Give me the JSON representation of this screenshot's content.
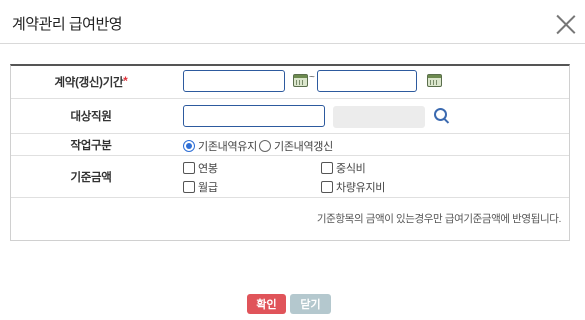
{
  "dialog": {
    "title": "계약관리 급여반영"
  },
  "form": {
    "period": {
      "label": "계약(갱신)기간",
      "required_mark": "*",
      "start_value": "",
      "end_value": "",
      "separator": "~"
    },
    "employee": {
      "label": "대상직원",
      "value": "",
      "name_value": ""
    },
    "work_type": {
      "label": "작업구분",
      "options": [
        {
          "label": "기존내역유지",
          "checked": true
        },
        {
          "label": "기존내역갱신",
          "checked": false
        }
      ]
    },
    "base_amount": {
      "label": "기준금액",
      "options": [
        {
          "label": "연봉",
          "checked": false
        },
        {
          "label": "중식비",
          "checked": false
        },
        {
          "label": "월급",
          "checked": false
        },
        {
          "label": "차량유지비",
          "checked": false
        }
      ]
    },
    "note": "기준항목의 금액이 있는경우만 급여기준금액에 반영됩니다."
  },
  "buttons": {
    "confirm": "확인",
    "close": "닫기"
  }
}
